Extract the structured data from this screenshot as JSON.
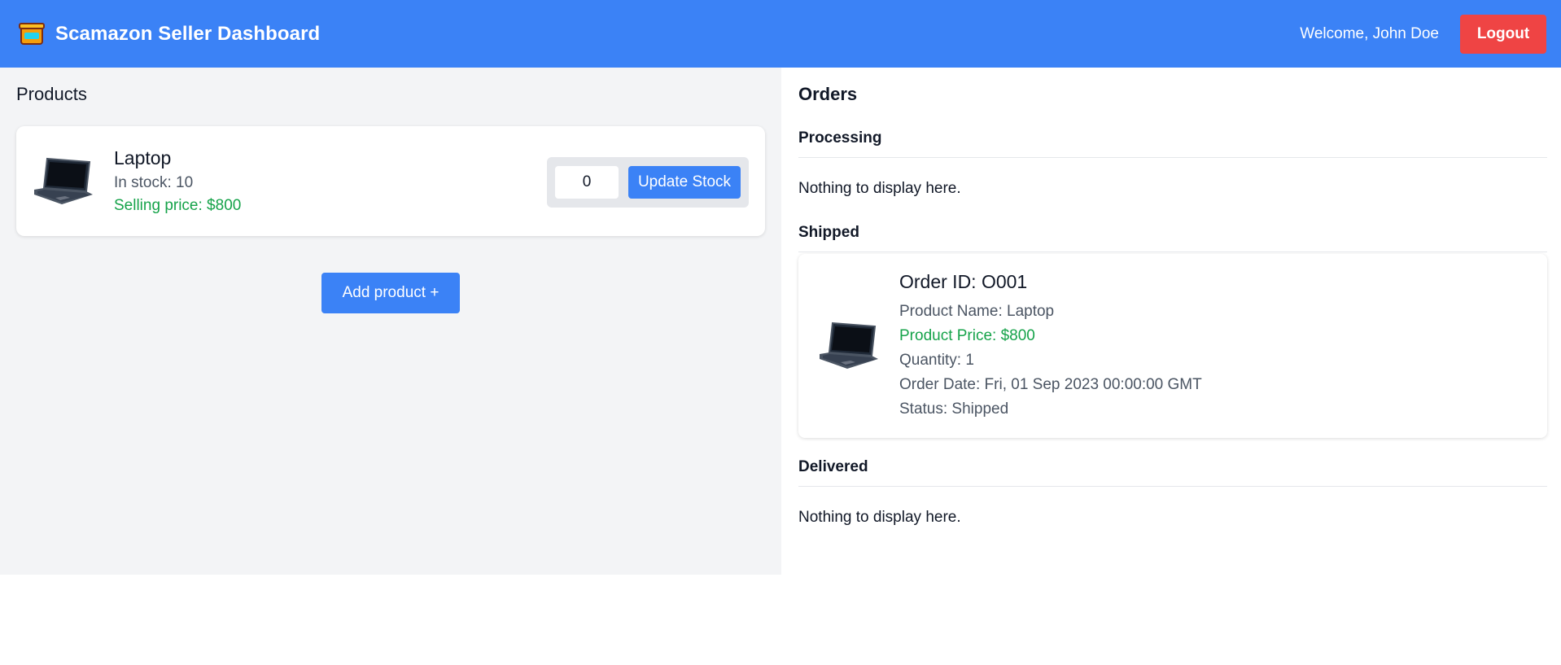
{
  "header": {
    "title": "Scamazon Seller Dashboard",
    "welcome": "Welcome, John Doe",
    "logout_label": "Logout",
    "logo_icon": "scamazon-box-logo-icon",
    "accent_color": "#3b82f6",
    "logout_color": "#ef4444"
  },
  "products": {
    "title": "Products",
    "items": [
      {
        "name": "Laptop",
        "stock_text": "In stock: 10",
        "price_text": "Selling price: $800",
        "image_icon": "laptop-icon",
        "stock_input_value": "0",
        "update_label": "Update Stock"
      }
    ],
    "add_label": "Add product +"
  },
  "orders": {
    "title": "Orders",
    "processing": {
      "heading": "Processing",
      "empty": "Nothing to display here."
    },
    "shipped": {
      "heading": "Shipped",
      "items": [
        {
          "order_id": "Order ID: O001",
          "product_name": "Product Name: Laptop",
          "product_price": "Product Price: $800",
          "quantity": "Quantity: 1",
          "order_date": "Order Date: Fri, 01 Sep 2023 00:00:00 GMT",
          "status": "Status: Shipped",
          "image_icon": "laptop-icon"
        }
      ]
    },
    "delivered": {
      "heading": "Delivered",
      "empty": "Nothing to display here."
    }
  },
  "colors": {
    "price_green": "#16a34a",
    "panel_gray": "#f3f4f6"
  }
}
